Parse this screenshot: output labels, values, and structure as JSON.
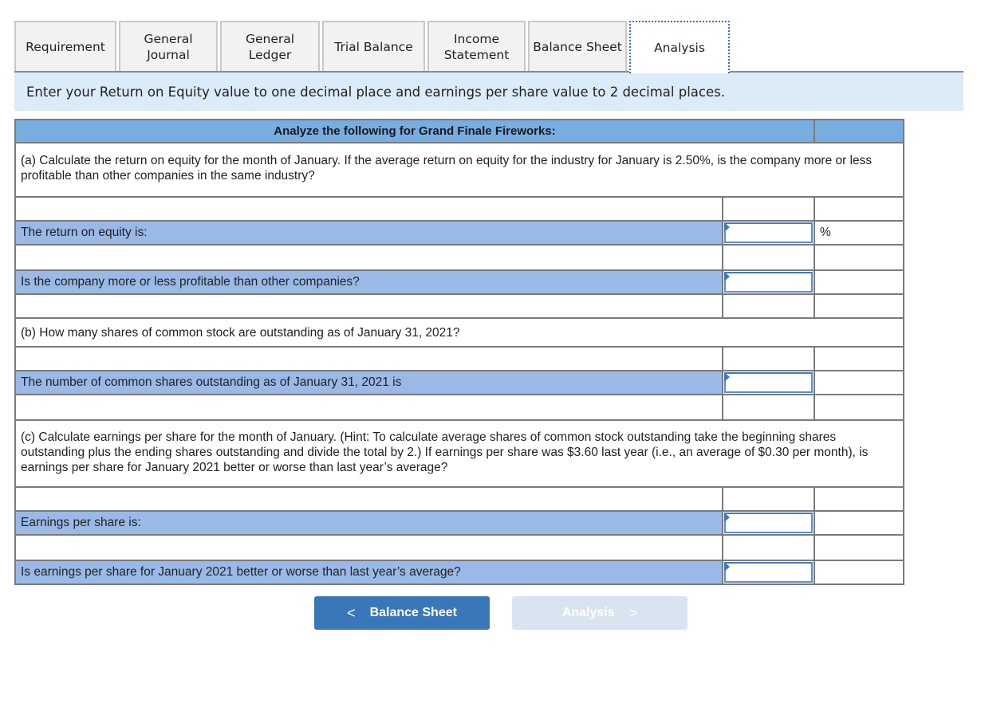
{
  "tabs": [
    {
      "label": "Requirement",
      "active": false
    },
    {
      "label": "General\nJournal",
      "active": false
    },
    {
      "label": "General\nLedger",
      "active": false
    },
    {
      "label": "Trial Balance",
      "active": false
    },
    {
      "label": "Income\nStatement",
      "active": false
    },
    {
      "label": "Balance Sheet",
      "active": false
    },
    {
      "label": "Analysis",
      "active": true
    }
  ],
  "instruction": "Enter your Return on Equity value to one decimal place and earnings per share value to 2 decimal places.",
  "table": {
    "header": "Analyze the following for Grand Finale Fireworks:",
    "part_a": {
      "question": "(a) Calculate the return on equity for the month of January. If the average return on equity for the industry for January is 2.50%, is the company more or less profitable than other companies in the same industry?",
      "roe_label": "The return on equity is:",
      "roe_value": "",
      "roe_unit": "%",
      "profitability_label": "Is the company more or less profitable than other companies?",
      "profitability_value": ""
    },
    "part_b": {
      "question": "(b) How many shares of common stock are outstanding as of January 31, 2021?",
      "shares_label": "The number of common shares outstanding as of January 31, 2021 is",
      "shares_value": ""
    },
    "part_c": {
      "question": "(c) Calculate earnings per share for the month of January. (Hint: To calculate average shares of common stock outstanding take the beginning shares outstanding plus the ending shares outstanding and divide the total by 2.) If earnings per share was $3.60 last year (i.e., an average of $0.30  per month), is earnings per share for January 2021 better or worse than last year’s average?",
      "eps_label": "Earnings per share is:",
      "eps_value": "",
      "comparison_label": "Is earnings per share for January 2021 better or worse than last year’s average?",
      "comparison_value": ""
    }
  },
  "nav": {
    "prev_label": "Balance Sheet",
    "prev_icon": "chevron-left-icon",
    "next_label": "Analysis",
    "next_icon": "chevron-right-icon",
    "next_enabled": false
  },
  "colors": {
    "header_blue": "#78ade2",
    "label_blue": "#9ab9e6",
    "banner_bg": "#dcebf8",
    "primary_button": "#3a77b9",
    "disabled_button": "#d9e4f1"
  }
}
